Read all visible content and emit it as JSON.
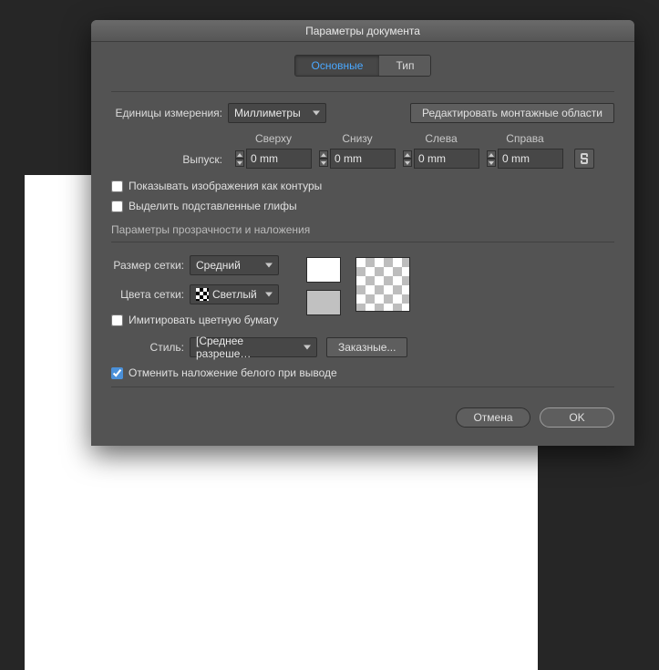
{
  "dialog": {
    "title": "Параметры документа",
    "tabs": {
      "main": "Основные",
      "type": "Тип"
    },
    "units_label": "Единицы измерения:",
    "units_value": "Миллиметры",
    "edit_artboards": "Редактировать монтажные области",
    "bleed_label": "Выпуск:",
    "bleed": {
      "top_label": "Сверху",
      "bottom_label": "Снизу",
      "left_label": "Слева",
      "right_label": "Справа",
      "top": "0 mm",
      "bottom": "0 mm",
      "left": "0 mm",
      "right": "0 mm"
    },
    "show_outlines": "Показывать изображения как контуры",
    "highlight_glyphs": "Выделить подставленные глифы",
    "transparency_title": "Параметры прозрачности и наложения",
    "grid_size_label": "Размер сетки:",
    "grid_size_value": "Средний",
    "grid_colors_label": "Цвета сетки:",
    "grid_colors_value": "Светлый",
    "simulate_paper": "Имитировать цветную бумагу",
    "style_label": "Стиль:",
    "style_value": "[Среднее разреше…",
    "custom_btn": "Заказные...",
    "reset_white": "Отменить наложение белого при выводе",
    "cancel": "Отмена",
    "ok": "OK"
  }
}
